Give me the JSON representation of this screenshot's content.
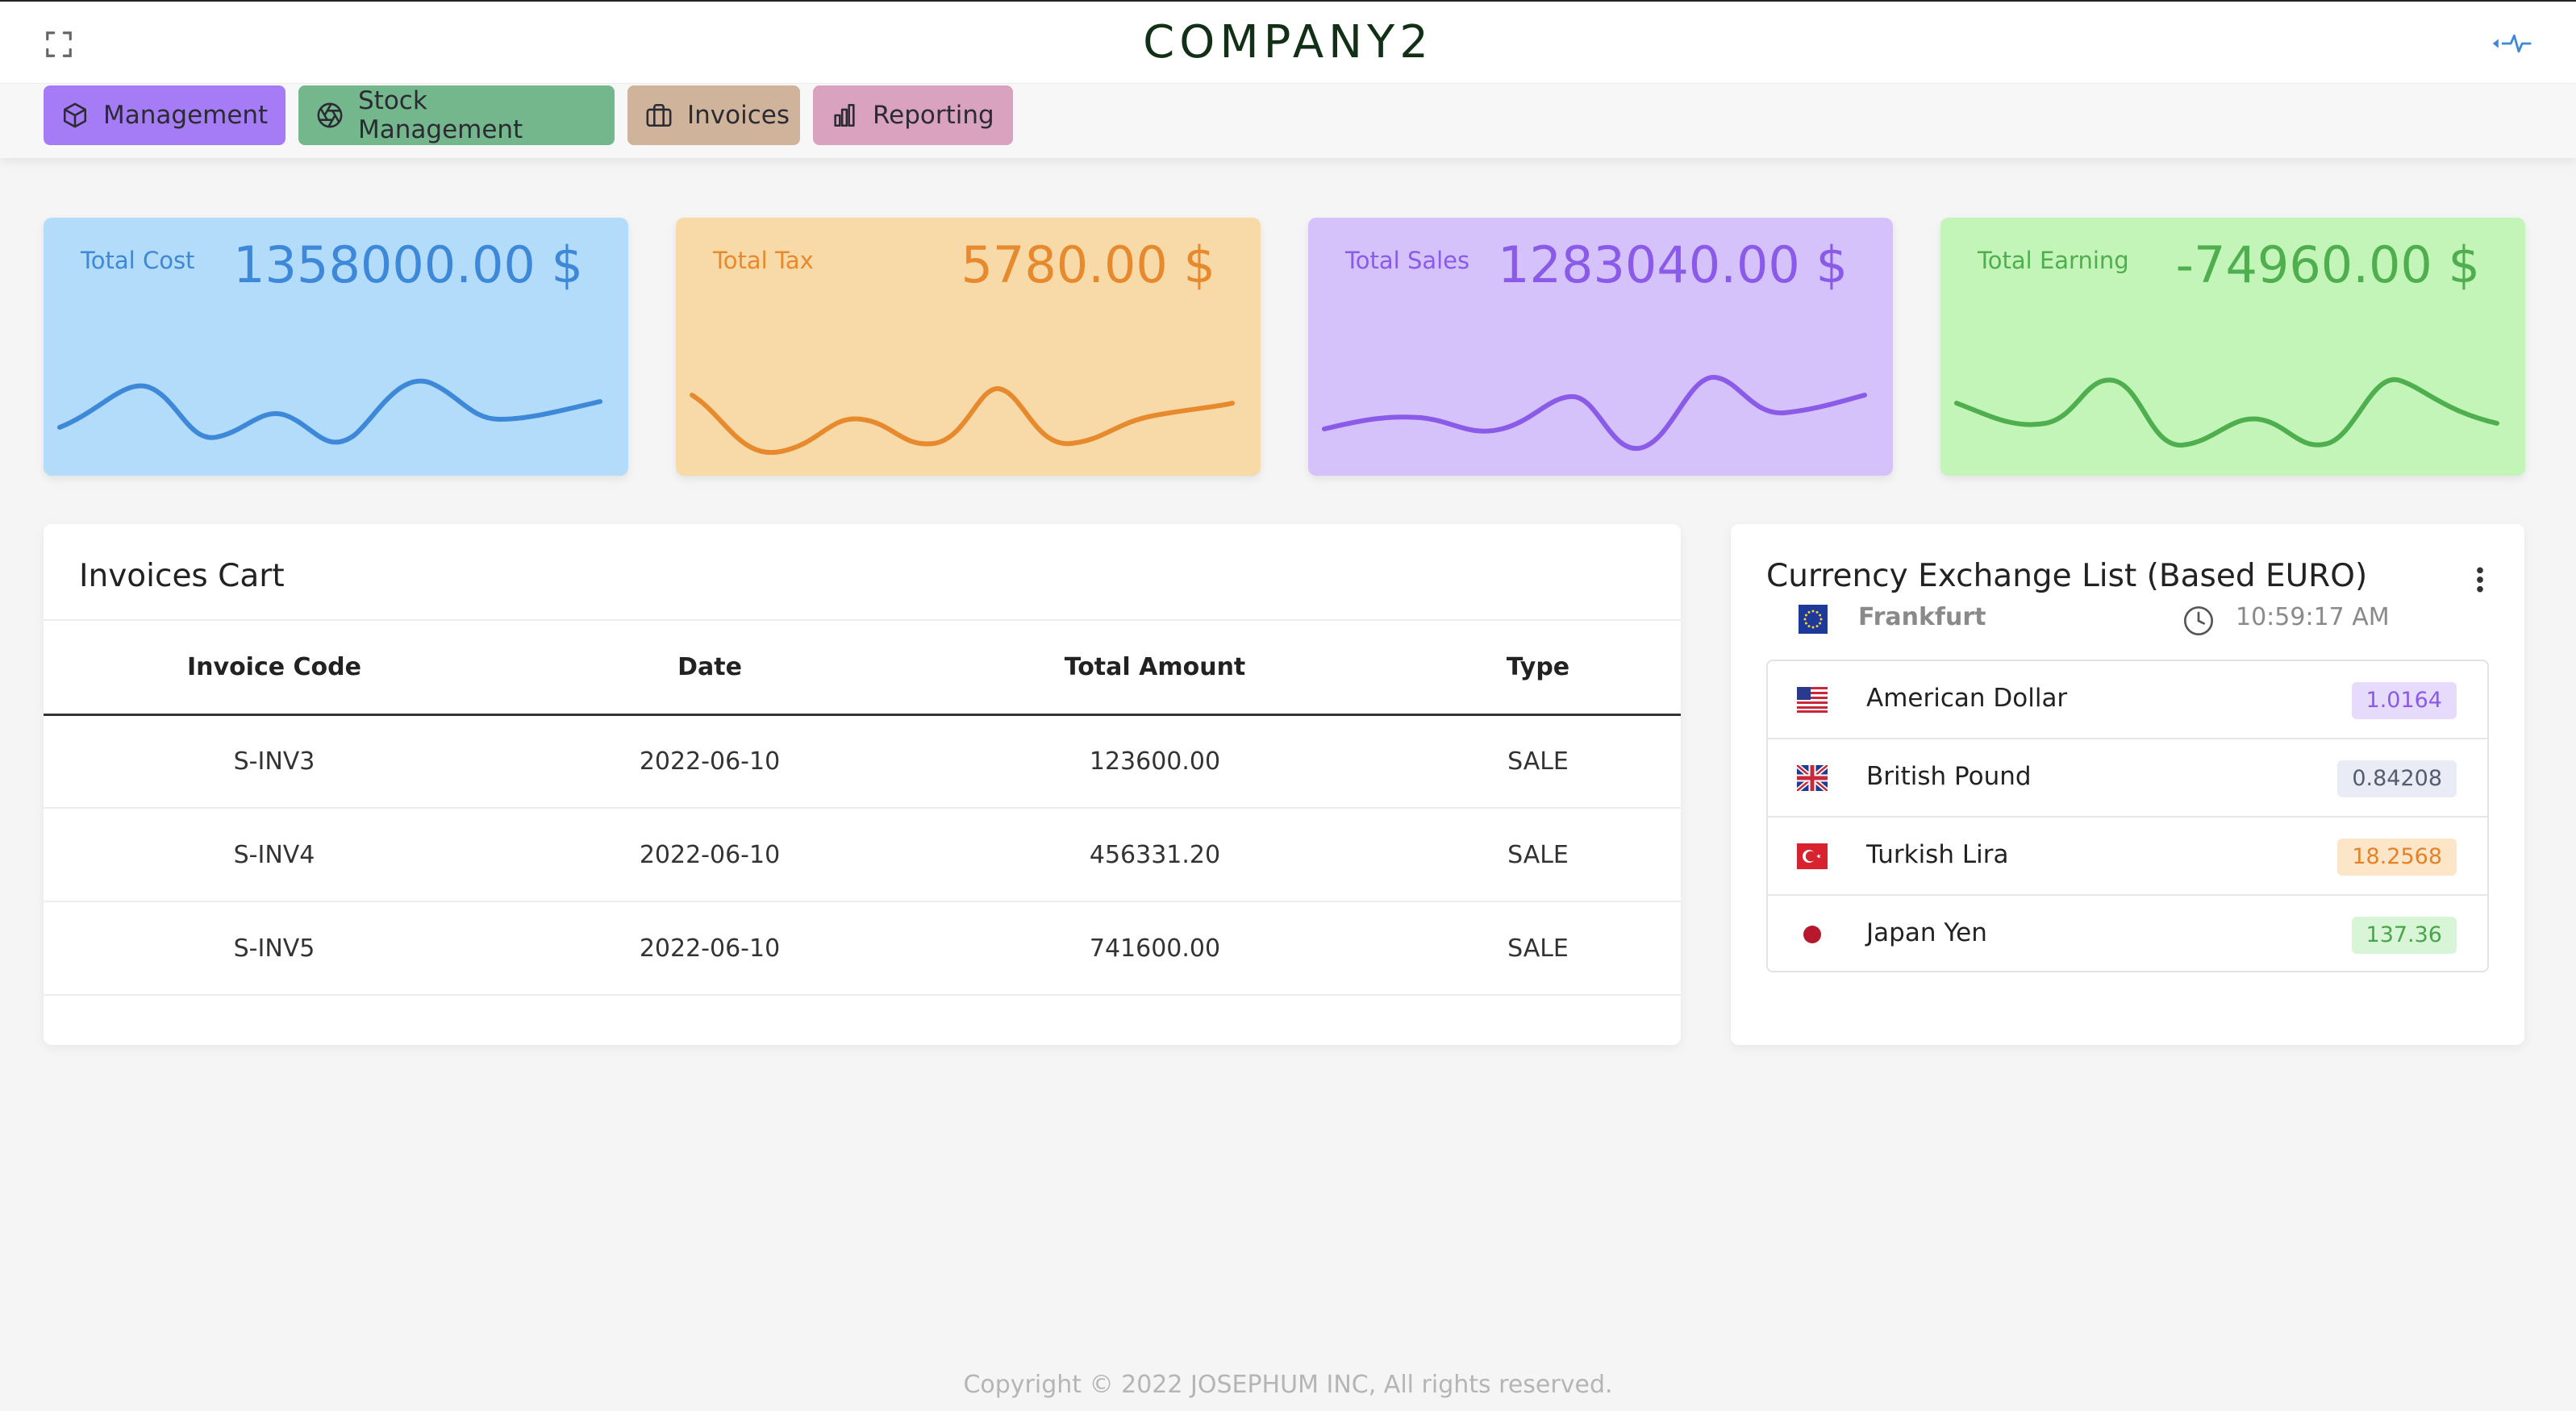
{
  "app": {
    "brand": "COMPANY2"
  },
  "nav": [
    {
      "label": "Management",
      "icon": "cube-icon"
    },
    {
      "label": "Stock Management",
      "icon": "aperture-icon"
    },
    {
      "label": "Invoices",
      "icon": "briefcase-icon"
    },
    {
      "label": "Reporting",
      "icon": "bar-chart-icon"
    }
  ],
  "stats": [
    {
      "label": "Total Cost",
      "value": "1358000.00 $",
      "color": "#3d88d8",
      "bg": "#b2dcfa"
    },
    {
      "label": "Total Tax",
      "value": "5780.00 $",
      "color": "#e78a2d",
      "bg": "#f8d9a8"
    },
    {
      "label": "Total Sales",
      "value": "1283040.00 $",
      "color": "#8a5ae8",
      "bg": "#d6c2fa"
    },
    {
      "label": "Total Earning",
      "value": "-74960.00 $",
      "color": "#4faf4f",
      "bg": "#c3f4b8"
    }
  ],
  "invoices": {
    "title": "Invoices Cart",
    "columns": [
      "Invoice Code",
      "Date",
      "Total Amount",
      "Type"
    ],
    "rows": [
      [
        "S-INV3",
        "2022-06-10",
        "123600.00",
        "SALE"
      ],
      [
        "S-INV4",
        "2022-06-10",
        "456331.20",
        "SALE"
      ],
      [
        "S-INV5",
        "2022-06-10",
        "741600.00",
        "SALE"
      ]
    ]
  },
  "fx": {
    "title": "Currency Exchange List (Based EURO)",
    "city": "Frankfurt",
    "time": "10:59:17 AM",
    "rates": [
      {
        "name": "American Dollar",
        "rate": "1.0164",
        "flag": "us-flag-icon"
      },
      {
        "name": "British Pound",
        "rate": "0.84208",
        "flag": "uk-flag-icon"
      },
      {
        "name": "Turkish Lira",
        "rate": "18.2568",
        "flag": "tr-flag-icon"
      },
      {
        "name": "Japan Yen",
        "rate": "137.36",
        "flag": "jp-flag-icon"
      }
    ]
  },
  "footer": {
    "text": "Copyright © 2022  JOSEPHUM INC, All rights reserved."
  }
}
